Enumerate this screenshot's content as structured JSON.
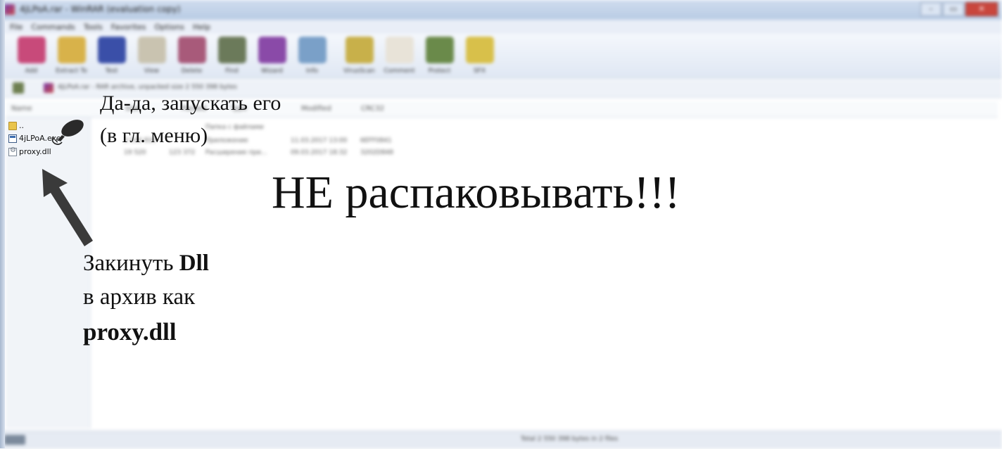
{
  "window": {
    "title": "4jLPoA.rar - WinRAR (evaluation copy)",
    "controls": [
      "–",
      "▭",
      "✕"
    ]
  },
  "menu": [
    "File",
    "Commands",
    "Tools",
    "Favorites",
    "Options",
    "Help"
  ],
  "toolbar": [
    {
      "label": "Add",
      "icon": "add-icon",
      "color": "#c84a7a"
    },
    {
      "label": "Extract To",
      "icon": "extract-icon",
      "color": "#d8b24a"
    },
    {
      "label": "Test",
      "icon": "test-icon",
      "color": "#3a4fa8"
    },
    {
      "label": "View",
      "icon": "view-icon",
      "color": "#c9c3b0"
    },
    {
      "label": "Delete",
      "icon": "delete-icon",
      "color": "#a85a7a"
    },
    {
      "label": "Find",
      "icon": "find-icon",
      "color": "#6b7a5a"
    },
    {
      "label": "Wizard",
      "icon": "wizard-icon",
      "color": "#8a4aa8"
    },
    {
      "label": "Info",
      "icon": "info-icon",
      "color": "#7aa0c8"
    },
    {
      "label": "VirusScan",
      "icon": "virusscan-icon",
      "color": "#c8b04a"
    },
    {
      "label": "Comment",
      "icon": "comment-icon",
      "color": "#e8e3d8"
    },
    {
      "label": "Protect",
      "icon": "protect-icon",
      "color": "#6a8a4a"
    },
    {
      "label": "SFX",
      "icon": "sfx-icon",
      "color": "#d8c04a"
    }
  ],
  "address": {
    "text": "4jLPoA.rar - RAR archive, unpacked size 2 550 398 bytes"
  },
  "list": {
    "headers": [
      "Name",
      "Size",
      "Packed",
      "Type",
      "Modified",
      "CRC32"
    ],
    "rows": [
      {
        "name": "..",
        "icon": "folder-icon",
        "type": "Папка с файлами"
      },
      {
        "name": "4jLPoA.exe",
        "icon": "exe-icon",
        "size": "2 530 816",
        "packed": "",
        "type": "Приложение",
        "modified": "11.03.2017 13:00",
        "crc": "6EFF0841"
      },
      {
        "name": "proxy.dll",
        "icon": "dll-icon",
        "size": "19 520",
        "packed": "123 372",
        "type": "Расширение при...",
        "modified": "09.03.2017 18:32",
        "crc": "3202D848"
      }
    ]
  },
  "status": {
    "text": "Total 2 550 398 bytes in 2 files"
  },
  "annotations": {
    "run_line1": "Да-да, запускать его",
    "run_line2": "(в гл. меню)",
    "dont_unpack": "НЕ распаковывать!!!",
    "add_dll_prefix": "Закинуть ",
    "add_dll_bold": "Dll",
    "add_dll_line2": "в архив как",
    "add_dll_line3": "proxy.dll"
  }
}
